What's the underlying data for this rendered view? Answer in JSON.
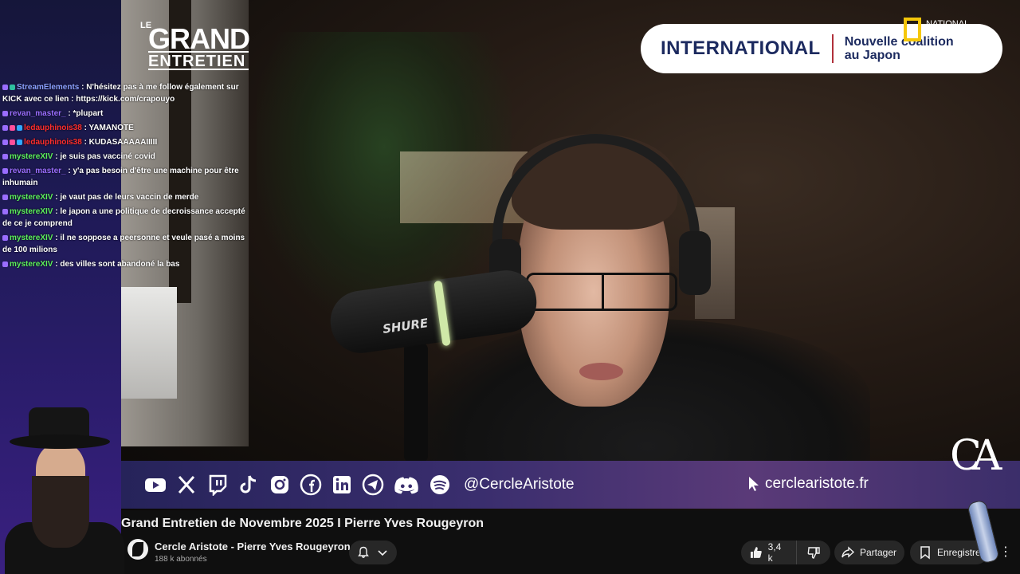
{
  "chat": {
    "messages": [
      {
        "user": "StreamElements",
        "text": " : N'hésitez pas à me follow également sur KICK avec ce lien : https://kick.com/crapouyo",
        "color": "#8ba0ff"
      },
      {
        "user": "revan_master_",
        "text": " : *plupart",
        "color": "#9a6dff"
      },
      {
        "user": "ledauphinois38",
        "text": " : YAMANOTE",
        "color": "#ff2d2d"
      },
      {
        "user": "ledauphinois38",
        "text": " : KUDASAAAAAIIIII",
        "color": "#ff2d2d"
      },
      {
        "user": "mystereXIV",
        "text": " : je suis pas vacciné covid",
        "color": "#5cf05c"
      },
      {
        "user": "revan_master_",
        "text": " : y'a pas besoin d'être une machine pour être inhumain",
        "color": "#9a6dff"
      },
      {
        "user": "mystereXIV",
        "text": " : je vaut pas de leurs vaccin de merde",
        "color": "#5cf05c"
      },
      {
        "user": "mystereXIV",
        "text": " : le japon a une politique de decroissance accepté de ce je comprend",
        "color": "#5cf05c"
      },
      {
        "user": "mystereXIV",
        "text": " : il ne soppose a peersonne et veule pasé a moins de 100 milions",
        "color": "#5cf05c"
      },
      {
        "user": "mystereXIV",
        "text": " : des villes sont abandoné la bas",
        "color": "#5cf05c"
      }
    ]
  },
  "overlay": {
    "logo_le": "LE",
    "logo_grand": "GRAND",
    "logo_entretien": "ENTRETIEN",
    "banner_title": "INTERNATIONAL",
    "banner_subtitle": "Nouvelle coalition au Japon",
    "natgeo_text": "NATIONAL",
    "mic_brand": "SHURE",
    "handle": "@CercleAristote",
    "website": "cerclearistote.fr",
    "ca_logo": "CA"
  },
  "video": {
    "title": "Grand Entretien de Novembre 2025 I Pierre Yves Rougeyron",
    "channel_name": "Cercle Aristote - Pierre Yves Rougeyron",
    "subscribers": "188 k abonnés",
    "likes": "3,4 k",
    "share_label": "Partager",
    "save_label": "Enregistrer",
    "more_label": "⋮"
  },
  "colors": {
    "accent_banner": "#1c2a5f",
    "banner_separator": "#b0303a",
    "natgeo_yellow": "#f5c70a"
  }
}
